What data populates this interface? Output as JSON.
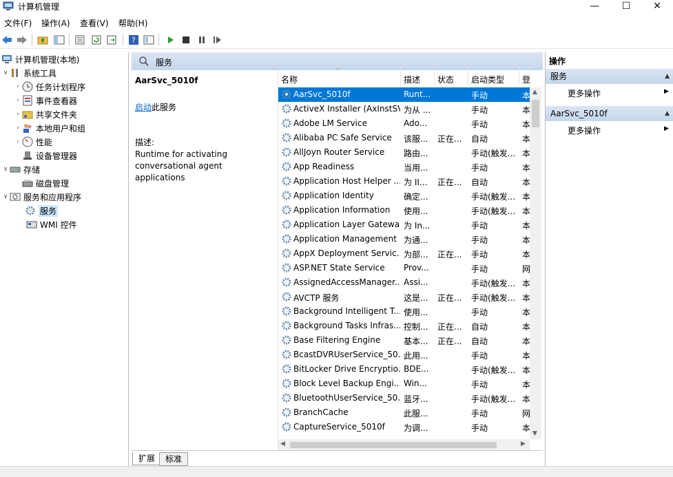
{
  "window": {
    "title": "计算机管理",
    "controls": [
      "—",
      "☐",
      "✕"
    ]
  },
  "menu": [
    "文件(F)",
    "操作(A)",
    "查看(V)",
    "帮助(H)"
  ],
  "toolbar": {
    "icons": [
      "back-icon",
      "forward-icon",
      "up-folder-icon",
      "show-hide-tree-icon",
      "properties-icon",
      "refresh-icon",
      "export-icon",
      "help-icon",
      "view-icon",
      "play-icon",
      "stop-icon",
      "pause-icon",
      "restart-icon"
    ]
  },
  "tree": {
    "root": "计算机管理(本地)",
    "system_tools": "系统工具",
    "task_scheduler": "任务计划程序",
    "event_viewer": "事件查看器",
    "shared_folders": "共享文件夹",
    "local_users": "本地用户和组",
    "performance": "性能",
    "device_manager": "设备管理器",
    "storage": "存储",
    "disk_management": "磁盘管理",
    "services_apps": "服务和应用程序",
    "services": "服务",
    "wmi": "WMI 控件"
  },
  "center": {
    "header": "服务",
    "selected_name": "AarSvc_5010f",
    "start_link": "启动",
    "start_suffix": "此服务",
    "desc_label": "描述:",
    "desc_line1": "Runtime for activating",
    "desc_line2": "conversational agent applications",
    "columns": [
      "名称",
      "描述",
      "状态",
      "启动类型",
      "登"
    ],
    "rows": [
      {
        "name": "AarSvc_5010f",
        "desc": "Runt...",
        "status": "",
        "startup": "手动",
        "logon": "本"
      },
      {
        "name": "ActiveX Installer (AxInstSV)",
        "desc": "为从 ...",
        "status": "",
        "startup": "手动",
        "logon": "本"
      },
      {
        "name": "Adobe LM Service",
        "desc": "Ado...",
        "status": "",
        "startup": "手动",
        "logon": "本"
      },
      {
        "name": "Alibaba PC Safe Service",
        "desc": "该服...",
        "status": "正在...",
        "startup": "自动",
        "logon": "本"
      },
      {
        "name": "AllJoyn Router Service",
        "desc": "路由...",
        "status": "",
        "startup": "手动(触发...",
        "logon": "本"
      },
      {
        "name": "App Readiness",
        "desc": "当用...",
        "status": "",
        "startup": "手动",
        "logon": "本"
      },
      {
        "name": "Application Host Helper ...",
        "desc": "为 II...",
        "status": "正在...",
        "startup": "自动",
        "logon": "本"
      },
      {
        "name": "Application Identity",
        "desc": "确定...",
        "status": "",
        "startup": "手动(触发...",
        "logon": "本"
      },
      {
        "name": "Application Information",
        "desc": "使用...",
        "status": "",
        "startup": "手动(触发...",
        "logon": "本"
      },
      {
        "name": "Application Layer Gatewa...",
        "desc": "为 In...",
        "status": "",
        "startup": "手动",
        "logon": "本"
      },
      {
        "name": "Application Management",
        "desc": "为通...",
        "status": "",
        "startup": "手动",
        "logon": "本"
      },
      {
        "name": "AppX Deployment Servic...",
        "desc": "为部...",
        "status": "正在...",
        "startup": "手动",
        "logon": "本"
      },
      {
        "name": "ASP.NET State Service",
        "desc": "Prov...",
        "status": "",
        "startup": "手动",
        "logon": "网"
      },
      {
        "name": "AssignedAccessManager...",
        "desc": "Assi...",
        "status": "",
        "startup": "手动(触发...",
        "logon": "本"
      },
      {
        "name": "AVCTP 服务",
        "desc": "这是...",
        "status": "正在...",
        "startup": "手动(触发...",
        "logon": "本"
      },
      {
        "name": "Background Intelligent T...",
        "desc": "使用...",
        "status": "",
        "startup": "手动",
        "logon": "本"
      },
      {
        "name": "Background Tasks Infras...",
        "desc": "控制...",
        "status": "正在...",
        "startup": "自动",
        "logon": "本"
      },
      {
        "name": "Base Filtering Engine",
        "desc": "基本...",
        "status": "正在...",
        "startup": "自动",
        "logon": "本"
      },
      {
        "name": "BcastDVRUserService_50...",
        "desc": "此用...",
        "status": "",
        "startup": "手动",
        "logon": "本"
      },
      {
        "name": "BitLocker Drive Encryptio...",
        "desc": "BDE...",
        "status": "",
        "startup": "手动(触发...",
        "logon": "本"
      },
      {
        "name": "Block Level Backup Engi...",
        "desc": "Win...",
        "status": "",
        "startup": "手动",
        "logon": "本"
      },
      {
        "name": "BluetoothUserService_50...",
        "desc": "蓝牙...",
        "status": "",
        "startup": "手动(触发...",
        "logon": "本"
      },
      {
        "name": "BranchCache",
        "desc": "此服...",
        "status": "",
        "startup": "手动",
        "logon": "网"
      },
      {
        "name": "CaptureService_5010f",
        "desc": "为调...",
        "status": "",
        "startup": "手动",
        "logon": "本"
      }
    ],
    "tabs": [
      "扩展",
      "标准"
    ]
  },
  "actions": {
    "title": "操作",
    "sections": [
      {
        "title": "服务",
        "item": "更多操作"
      },
      {
        "title": "AarSvc_5010f",
        "item": "更多操作"
      }
    ]
  },
  "colors": {
    "selection": "#0078d7",
    "link": "#0066cc",
    "header_gradient": "#c4d6ec"
  }
}
